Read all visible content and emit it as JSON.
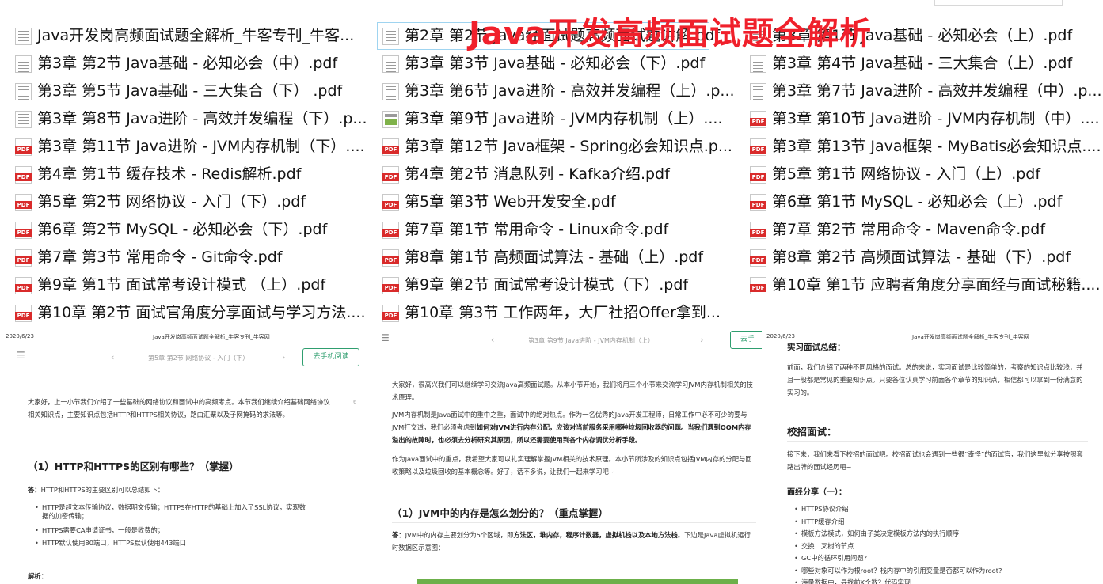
{
  "overlay_title": "Java开发高频面试题全解析",
  "files": [
    {
      "name": "Java开发岗高频面试题全解析_牛客专刊_牛客...",
      "icon": "doc-icon"
    },
    {
      "name": "第2章 第2节 Java经面试题高频面试题讲解.pdf",
      "icon": "doc-icon"
    },
    {
      "name": "第3章 第1节 Java基础 - 必知必会（上）.pdf",
      "icon": "doc-icon"
    },
    {
      "name": "第3章 第2节 Java基础 - 必知必会（中）.pdf",
      "icon": "doc-icon"
    },
    {
      "name": "第3章 第3节 Java基础 - 必知必会（下）.pdf",
      "icon": "doc-icon"
    },
    {
      "name": "第3章 第4节 Java基础 - 三大集合（上）.pdf",
      "icon": "doc-icon"
    },
    {
      "name": "第3章 第5节 Java基础 - 三大集合（下） .pdf",
      "icon": "doc-icon"
    },
    {
      "name": "第3章 第6节 Java进阶 - 高效并发编程（上）.p...",
      "icon": "doc-icon"
    },
    {
      "name": "第3章 第7节 Java进阶 - 高效并发编程（中）.p...",
      "icon": "doc-icon"
    },
    {
      "name": "第3章 第8节 Java进阶 - 高效并发编程（下）.p...",
      "icon": "doc-icon"
    },
    {
      "name": "第3章 第9节 Java进阶 - JVM内存机制（上）....",
      "icon": "image-doc-icon"
    },
    {
      "name": "第3章 第10节 Java进阶 - JVM内存机制（中）....",
      "icon": "pdf-icon"
    },
    {
      "name": "第3章 第11节 Java进阶 - JVM内存机制（下）....",
      "icon": "pdf-icon"
    },
    {
      "name": "第3章 第12节 Java框架 - Spring必会知识点.p...",
      "icon": "pdf-icon"
    },
    {
      "name": "第3章 第13节 Java框架 - MyBatis必会知识点....",
      "icon": "pdf-icon"
    },
    {
      "name": "第4章 第1节 缓存技术 - Redis解析.pdf",
      "icon": "pdf-icon"
    },
    {
      "name": "第4章 第2节 消息队列 - Kafka介绍.pdf",
      "icon": "pdf-icon"
    },
    {
      "name": "第5章 第1节 网络协议 - 入门（上）.pdf",
      "icon": "pdf-icon"
    },
    {
      "name": "第5章 第2节 网络协议 - 入门（下）.pdf",
      "icon": "pdf-icon"
    },
    {
      "name": "第5章 第3节 Web开发安全.pdf",
      "icon": "pdf-icon"
    },
    {
      "name": "第6章 第1节 MySQL - 必知必会（上）.pdf",
      "icon": "pdf-icon"
    },
    {
      "name": "第6章 第2节 MySQL - 必知必会（下）.pdf",
      "icon": "pdf-icon"
    },
    {
      "name": "第7章 第1节 常用命令 - Linux命令.pdf",
      "icon": "pdf-icon"
    },
    {
      "name": "第7章 第2节 常用命令 - Maven命令.pdf",
      "icon": "pdf-icon"
    },
    {
      "name": "第7章 第3节 常用命令 - Git命令.pdf",
      "icon": "pdf-icon"
    },
    {
      "name": "第8章 第1节 高频面试算法 - 基础（上）.pdf",
      "icon": "pdf-icon"
    },
    {
      "name": "第8章 第2节 高频面试算法 - 基础（下）.pdf",
      "icon": "pdf-icon"
    },
    {
      "name": "第9章 第1节 面试常考设计模式 （上）.pdf",
      "icon": "pdf-icon"
    },
    {
      "name": "第9章 第2节 面试常考设计模式（下）.pdf",
      "icon": "pdf-icon"
    },
    {
      "name": "第10章 第1节 应聘者角度分享面经与面试秘籍....",
      "icon": "pdf-icon"
    },
    {
      "name": "第10章 第2节 面试官角度分享面试与学习方法....",
      "icon": "pdf-icon"
    },
    {
      "name": "第10章 第3节 工作两年，大厂社招Offer拿到...",
      "icon": "pdf-icon"
    }
  ],
  "preview1": {
    "date": "2020/6/23",
    "header": "Java开发岗高频面试题全解析_牛客专刊_牛客网",
    "nav_title": "第5章 第2节 网络协议 - 入门（下）",
    "read_button": "去手机阅读",
    "page_num": "6",
    "intro": "大家好，上一小节我们介绍了一些基础的网络协议和面试中的高频考点。本节我们继续介绍基础网络协议相关知识点，主要知识点包括HTTP和HTTPS相关协议，路由汇聚以及子网掩码的求法等。",
    "heading": "（1）HTTP和HTTPS的区别有哪些？（掌握）",
    "answer_label": "答：",
    "answer": "HTTP和HTTPS的主要区别可以总结如下：",
    "bullets": [
      "HTTP是超文本传输协议，数据明文传输；HTTPS在HTTP的基础上加入了SSL协议，实现数",
      "据的加密传输；",
      "HTTPS需要CA申请证书，一般是收费的；",
      "HTTP默认使用80端口，HTTPS默认使用443端口"
    ],
    "analysis": "解析："
  },
  "preview2": {
    "nav_title": "第3章 第9节 Java进阶 - JVM内存机制（上）",
    "read_button": "去手",
    "para1": "大家好，很高兴我们可以继续学习交流Java高频面试题。从本小节开始，我们将用三个小节来交流学习JVM内存机制相关的技术原理。",
    "para2_a": "JVM内存机制是Java面试中的重中之重，面试中的绝对热点。作为一名优秀的Java开发工程师，日常工作中必不可少的要与JVM打交道，我们必须考虑到",
    "para2_b": "如何对JVM进行内存分配，应该对当前服务采用哪种垃圾回收器的问题。当我们遇到OOM内存溢出的故障时，也必须去分析研究其原因，所以还需要使用到各个内存调优分析手段。",
    "para3": "作为Java面试中的重点，我希望大家可以扎实理解掌握JVM相关的技术原理。本小节所涉及的知识点包括JVM内存的分配与回收策略以及垃圾回收的基本概念等。好了，话不多说，让我们一起来学习吧~",
    "heading": "（1）JVM中的内存是怎么划分的？（重点掌握）",
    "answer_label": "答：",
    "answer_a": "JVM中的内存主要划分为5个区域，即",
    "answer_b": "方法区，堆内存，程序计数器，虚拟机栈以及本地方法栈",
    "answer_c": "。下边是Java虚拟机运行时数据区示意图："
  },
  "preview3": {
    "date": "2020/6/23",
    "header": "Java开发岗高频面试题全解析_牛客专刊_牛客网",
    "h_intern": "实习面试总结：",
    "p_intern": "前面，我们介绍了两种不同风格的面试。总的来说，实习面试是比较简单的，考察的知识点比较浅，并且一般都是常见的重要知识点。只要各位认真学习前面各个章节的知识点，相信都可以拿到一份满意的实习的。",
    "h_campus": "校招面试：",
    "p_campus": "接下来，我们来看下校招的面试吧。校招面试也会遇到一些很“奇怪”的面试官，我们这里就分享按照套路出牌的面试经历吧~",
    "h_share": "面经分享（一）：",
    "bullets": [
      "HTTPS协议介绍",
      "HTTP缓存介绍",
      "模板方法模式，如何由子类决定模板方法内的执行顺序",
      "交换二叉树的节点",
      "GC中的循环引用问题?",
      "哪些对象可以作为根root？栈内存中的引用变量是否都可以作为root?",
      "海量数据中，寻找前K个数？代码实现"
    ]
  },
  "colors": {
    "overlay": "#f0202b",
    "read_button": "#2f9e6f",
    "pdf_badge": "#d92b2b"
  }
}
